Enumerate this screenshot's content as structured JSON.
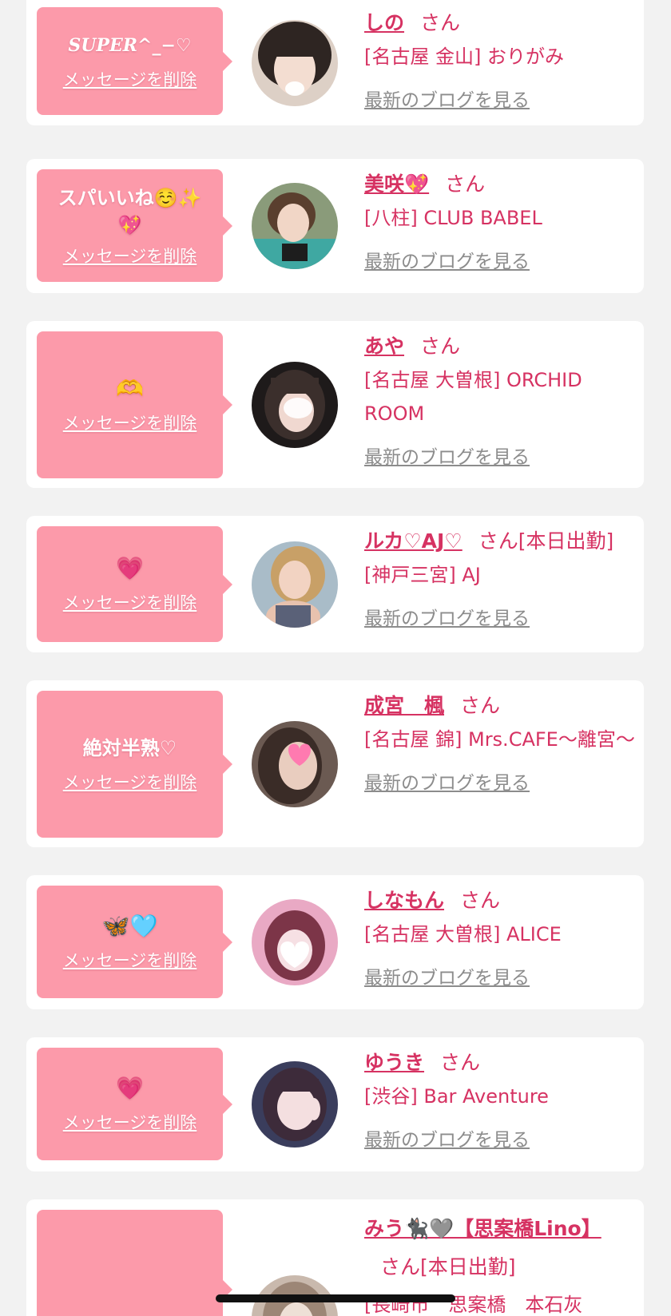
{
  "delete_label": "メッセージを削除",
  "blog_label": "最新のブログを見る",
  "san_label": "さん",
  "colors": {
    "page_bg": "#f2f2f2",
    "bubble_pink": "#fc9aaa",
    "accent_text": "#d63262",
    "muted_link": "#8c8c8c"
  },
  "messages": [
    {
      "message": "SUPER^_−♡",
      "name": "しの",
      "suffix": "",
      "shop": "[名古屋 金山] おりがみ"
    },
    {
      "message": "スパいいね☺️✨\n💖",
      "name": "美咲💖",
      "suffix": "",
      "shop": "[八柱] CLUB BABEL"
    },
    {
      "message": "🫶",
      "name": "あや",
      "suffix": "",
      "shop": "[名古屋 大曽根] ORCHID ROOM"
    },
    {
      "message": "💗",
      "name": "ルカ♡AJ♡",
      "suffix": "[本日出勤]",
      "shop": "[神戸三宮] AJ"
    },
    {
      "message": "絶対半熟♡",
      "name": "成宮　楓",
      "suffix": "",
      "shop": "[名古屋 錦] Mrs.CAFE〜離宮〜"
    },
    {
      "message": "🦋🩵",
      "name": "しなもん",
      "suffix": "",
      "shop": "[名古屋 大曽根] ALICE"
    },
    {
      "message": "💗",
      "name": "ゆうき",
      "suffix": "",
      "shop": "[渋谷] Bar Aventure"
    },
    {
      "message": "🐈‍⬛🩶❕",
      "name": "みう🐈‍⬛🩶【思案橋Lino】",
      "suffix": "[本日出勤]",
      "shop": "[長崎市　思案橋　本石灰"
    }
  ]
}
